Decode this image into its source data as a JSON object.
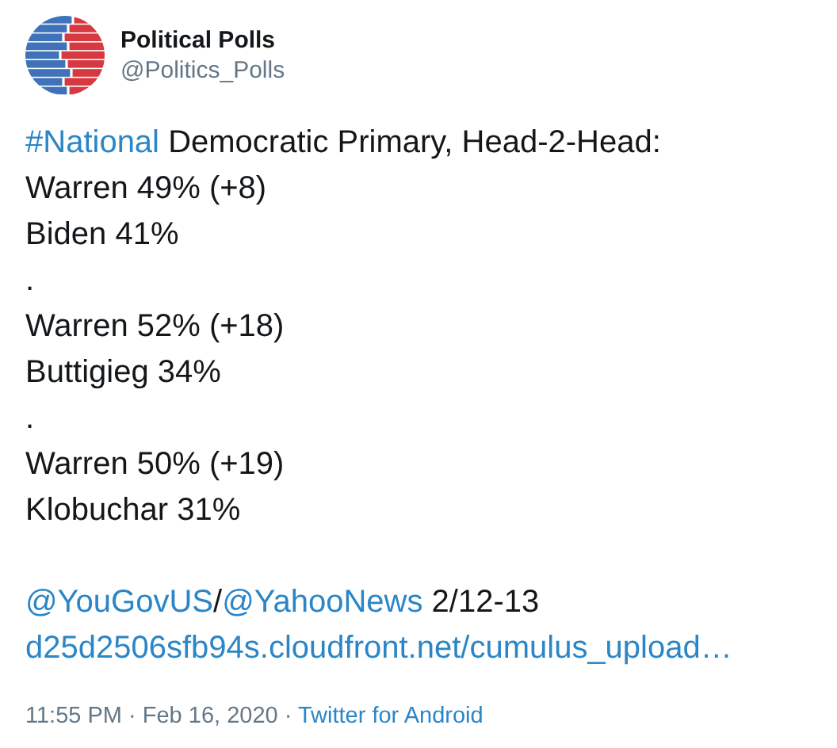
{
  "author": {
    "name": "Political Polls",
    "handle": "@Politics_Polls"
  },
  "body": [
    [
      {
        "kind": "link",
        "text": "#National"
      },
      {
        "kind": "text",
        "text": " Democratic Primary, Head-2-Head:"
      }
    ],
    [
      {
        "kind": "text",
        "text": "Warren 49% (+8)"
      }
    ],
    [
      {
        "kind": "text",
        "text": "Biden 41%"
      }
    ],
    [
      {
        "kind": "text",
        "text": "."
      }
    ],
    [
      {
        "kind": "text",
        "text": "Warren 52% (+18)"
      }
    ],
    [
      {
        "kind": "text",
        "text": "Buttigieg 34%"
      }
    ],
    [
      {
        "kind": "text",
        "text": "."
      }
    ],
    [
      {
        "kind": "text",
        "text": "Warren 50% (+19)"
      }
    ],
    [
      {
        "kind": "text",
        "text": "Klobuchar 31%"
      }
    ]
  ],
  "source": [
    [
      {
        "kind": "link",
        "text": "@YouGovUS"
      },
      {
        "kind": "text",
        "text": "/"
      },
      {
        "kind": "link",
        "text": "@YahooNews"
      },
      {
        "kind": "text",
        "text": " 2/12-13"
      }
    ],
    [
      {
        "kind": "link",
        "text": "d25d2506sfb94s.cloudfront.net/cumulus_upload…"
      }
    ]
  ],
  "footer": {
    "time": "11:55 PM · Feb 16, 2020 · ",
    "client": "Twitter for Android"
  }
}
